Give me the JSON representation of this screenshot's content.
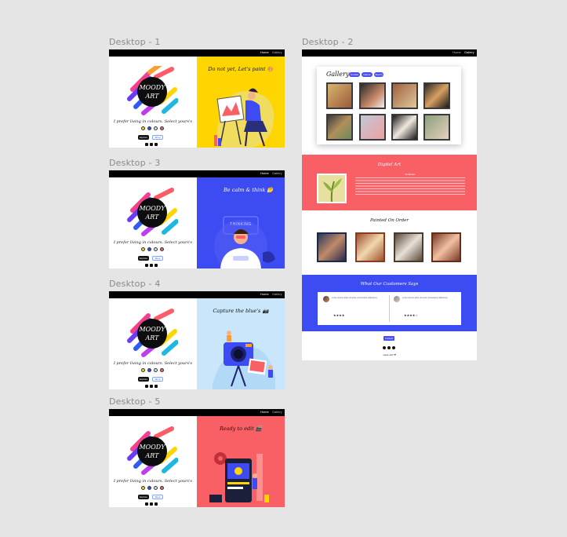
{
  "frames": {
    "d1": {
      "label": "Desktop - 1",
      "title": "Do not yet, Let's paint 🎨"
    },
    "d2": {
      "label": "Desktop - 2"
    },
    "d3": {
      "label": "Desktop - 3",
      "title": "Be calm & think 🤔",
      "bubble": "THINKING"
    },
    "d4": {
      "label": "Desktop - 4",
      "title": "Capture the blue's 📷"
    },
    "d5": {
      "label": "Desktop - 5",
      "title": "Ready to edit 🎬"
    }
  },
  "nav": {
    "home": "Home",
    "gallery": "Gallery"
  },
  "brand": {
    "line1": "MOODY",
    "line2": "ART"
  },
  "hero": {
    "tagline": "I prefer living in colours. Select yours's",
    "btn_primary": "Explore",
    "btn_secondary": "Shop"
  },
  "gallery": {
    "title": "Gallery",
    "filters": [
      "Portrait",
      "Nature",
      "Sketch"
    ]
  },
  "digital_art": {
    "title": "Digital Art",
    "subtitle": "Sunflower"
  },
  "painted": {
    "title": "Painted On Order"
  },
  "testimonials": {
    "title": "What Our Customers Says",
    "items": [
      {
        "text": "Lorem ipsum dolor sit amet consectetur adipiscing",
        "stars": "★★★★"
      },
      {
        "text": "Lorem ipsum dolor sit amet consectetur adipiscing",
        "stars": "★★★★☆"
      }
    ]
  },
  "footer": {
    "cta": "Contact",
    "credit": "made with ❤"
  },
  "colors": {
    "yellow": "#ffd500",
    "blue": "#3d4bf2",
    "lightblue": "#c9e6fb",
    "coral": "#f86066",
    "black": "#000000"
  }
}
